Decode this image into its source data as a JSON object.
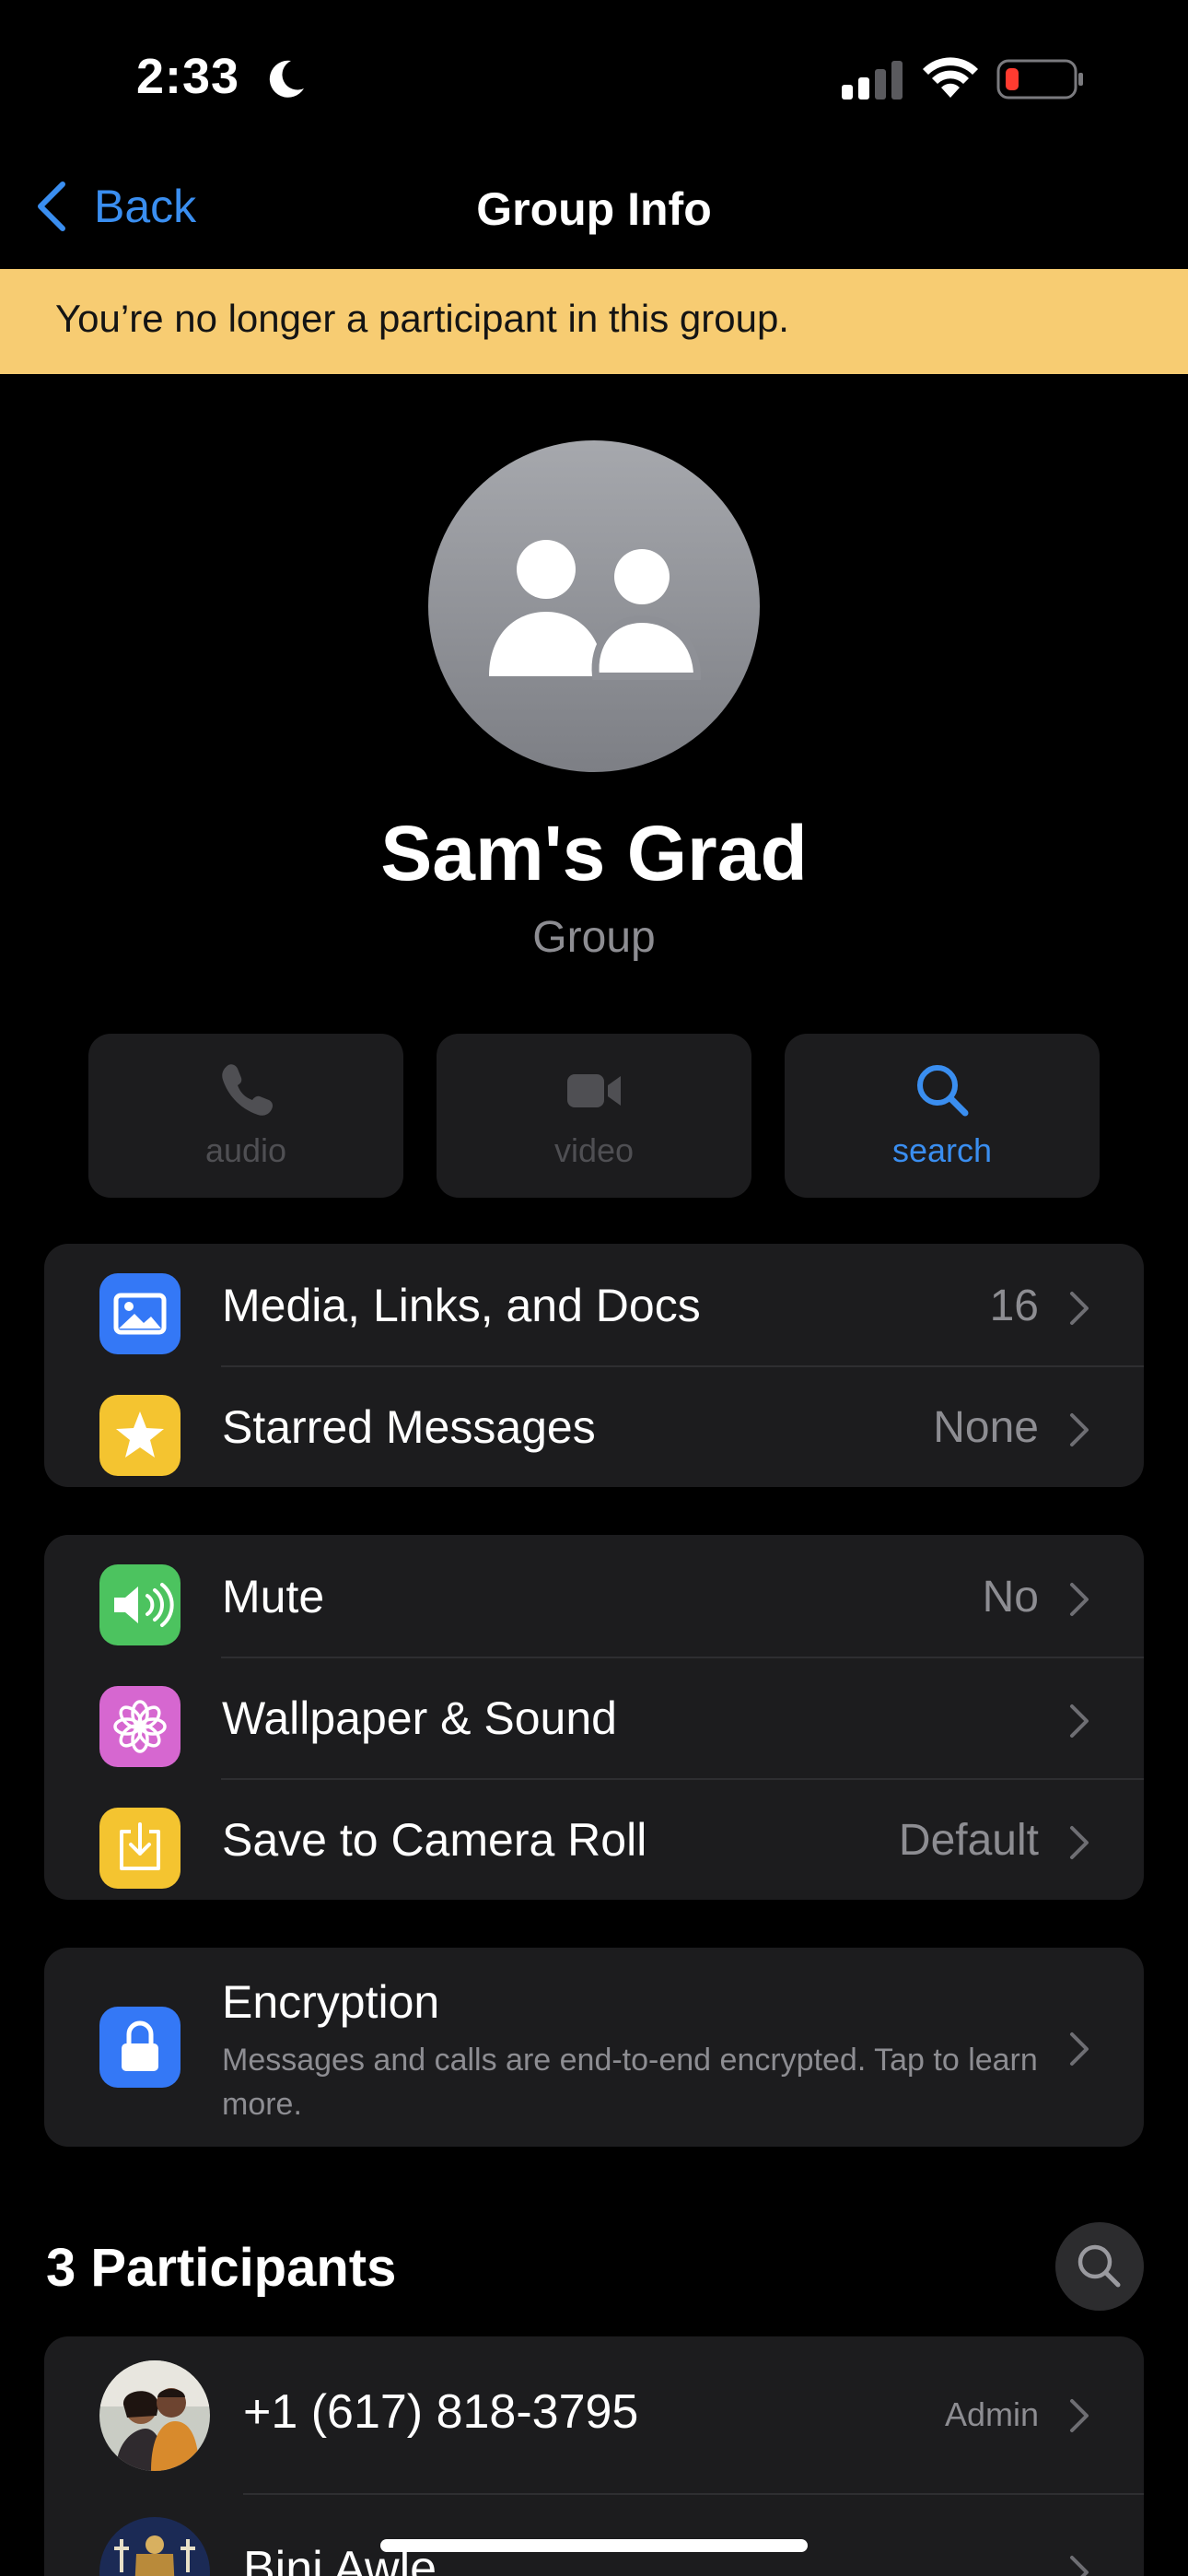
{
  "status_bar": {
    "time": "2:33",
    "battery_color": "#ff3b30"
  },
  "nav": {
    "back_label": "Back",
    "title": "Group Info"
  },
  "banner": {
    "text": "You’re no longer a participant in this group."
  },
  "group": {
    "name": "Sam's Grad",
    "subtitle": "Group"
  },
  "actions": [
    {
      "label": "audio",
      "icon": "phone-icon",
      "enabled": false
    },
    {
      "label": "video",
      "icon": "video-camera-icon",
      "enabled": false
    },
    {
      "label": "search",
      "icon": "magnifier-icon",
      "enabled": true
    }
  ],
  "media_section": [
    {
      "label": "Media, Links, and Docs",
      "value": "16",
      "icon": "photo-icon",
      "icon_color": "#3478f6"
    },
    {
      "label": "Starred Messages",
      "value": "None",
      "icon": "star-icon",
      "icon_color": "#f4c430"
    }
  ],
  "settings_section": [
    {
      "label": "Mute",
      "value": "No",
      "icon": "speaker-icon",
      "icon_color": "#4cc35f"
    },
    {
      "label": "Wallpaper & Sound",
      "value": "",
      "icon": "flower-icon",
      "icon_color": "#d667d0"
    },
    {
      "label": "Save to Camera Roll",
      "value": "Default",
      "icon": "download-icon",
      "icon_color": "#f4c430"
    }
  ],
  "encryption": {
    "title": "Encryption",
    "description": "Messages and calls are end-to-end encrypted. Tap to learn more.",
    "icon_color": "#3478f6"
  },
  "participants": {
    "header": "3 Participants",
    "items": [
      {
        "name": "+1 (617) 818-3795",
        "role": "Admin"
      },
      {
        "name": "Bini Awle",
        "role": ""
      }
    ]
  }
}
